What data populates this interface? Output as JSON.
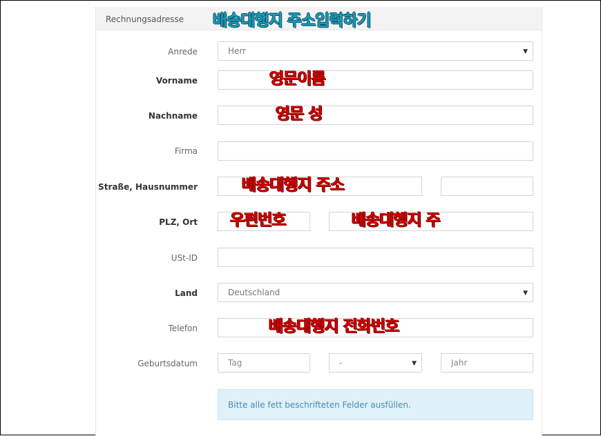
{
  "header": {
    "title": "Rechnungsadresse",
    "annotation": "배송대행지 주소입력하기"
  },
  "form": {
    "anrede": {
      "label": "Anrede",
      "value": "Herr"
    },
    "vorname": {
      "label": "Vorname",
      "annotation": "영문이름"
    },
    "nachname": {
      "label": "Nachname",
      "annotation": "영문 성"
    },
    "firma": {
      "label": "Firma"
    },
    "strasse": {
      "label": "Straße, Hausnummer",
      "annotation": "배송대행지 주소"
    },
    "plz": {
      "label": "PLZ, Ort",
      "annotation_plz": "우편번호",
      "annotation_ort": "배송대행지 주"
    },
    "ustid": {
      "label": "USt-ID"
    },
    "land": {
      "label": "Land",
      "value": "Deutschland"
    },
    "telefon": {
      "label": "Telefon",
      "annotation": "배송대행지 전화번호"
    },
    "geburtsdatum": {
      "label": "Geburtsdatum",
      "day_placeholder": "Tag",
      "month_value": "-",
      "year_placeholder": "Jahr"
    }
  },
  "notice": "Bitte alle fett beschrifteten Felder ausfüllen.",
  "colors": {
    "annotation_red": "#cc0000",
    "annotation_teal": "#1a9ab8",
    "notice_bg": "#dff0f8",
    "notice_text": "#4a8db3"
  }
}
